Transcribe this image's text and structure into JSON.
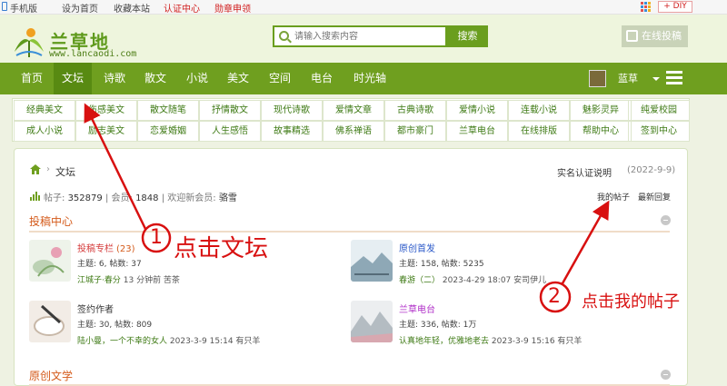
{
  "topbar": {
    "links": [
      "手机版",
      "设为首页",
      "收藏本站",
      "认证中心",
      "勋章申领"
    ],
    "diy_label": "DIY"
  },
  "header": {
    "logo_text": "兰草地",
    "logo_sub": "www.lancaodi.com",
    "search_placeholder": "请输入搜索内容",
    "search_button": "搜索",
    "post_button": "在线投稿"
  },
  "nav": {
    "items": [
      "首页",
      "文坛",
      "诗歌",
      "散文",
      "小说",
      "美文",
      "空间",
      "电台",
      "时光轴"
    ],
    "active_index": 1,
    "username": "蓝草"
  },
  "categories": [
    [
      "经典美文",
      "伤感美文",
      "散文随笔",
      "抒情散文",
      "现代诗歌",
      "爱情文章",
      "古典诗歌",
      "爱情小说",
      "连载小说",
      "魅影灵异",
      "纯爱校园"
    ],
    [
      "成人小说",
      "励志美文",
      "恋爱婚姻",
      "人生感悟",
      "故事精选",
      "佛系禅语",
      "都市豪门",
      "兰草电台",
      "在线排版",
      "帮助中心",
      "签到中心"
    ]
  ],
  "breadcrumb": {
    "label": "文坛",
    "sep": "›"
  },
  "notice": {
    "title": "实名认证说明",
    "date": "(2022-9-9)"
  },
  "stats": {
    "posts_label": "帖子:",
    "posts": "352879",
    "members_label": "会员:",
    "members": "1848",
    "welcome_label": "欢迎新会员:",
    "new_member": "骆雪"
  },
  "links": {
    "my_posts": "我的帖子",
    "latest_reply": "最新回复"
  },
  "sections": [
    {
      "title": "投稿中心",
      "forums": [
        {
          "name": "投稿专栏",
          "count": "(23)",
          "color": "#d43a3a",
          "stats": "主题: 6, 帖数: 37",
          "last_user": "江城子·春分",
          "last_rest": "13 分钟前 苦茶"
        },
        {
          "name": "原创首发",
          "count": "",
          "color": "#2a58c8",
          "stats": "主题: 158, 帖数: 5235",
          "last_user": "春游（二）",
          "last_rest": "2023-4-29 18:07 安司伊儿"
        },
        {
          "name": "签约作者",
          "count": "",
          "color": "#333333",
          "stats": "主题: 30, 帖数: 809",
          "last_user": "陆小曼，一个不幸的女人",
          "last_rest": "2023-3-9 15:14 有只羊"
        },
        {
          "name": "兰草电台",
          "count": "",
          "color": "#b030c8",
          "stats": "主题: 336, 帖数: 1万",
          "last_user": "认真地年轻，优雅地老去",
          "last_rest": "2023-3-9 15:16 有只羊"
        }
      ]
    },
    {
      "title": "原创文学",
      "forums": []
    }
  ],
  "annotations": {
    "step1_num": "1",
    "step1_text": "点击文坛",
    "step2_num": "2",
    "step2_text": "点击我的帖子",
    "color": "#d81010"
  }
}
